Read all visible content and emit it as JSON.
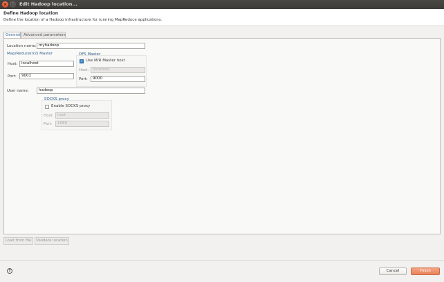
{
  "window": {
    "title": "Edit Hadoop location...",
    "close_icon": "close-icon",
    "maximize_icon": "maximize-icon"
  },
  "header": {
    "title": "Define Hadoop location",
    "description": "Define the location of a Hadoop infrastructure for running MapReduce applications."
  },
  "tabs": [
    {
      "label": "General",
      "selected": true
    },
    {
      "label": "Advanced parameters",
      "selected": false
    }
  ],
  "general": {
    "location_name_label": "Location name:",
    "location_name_value": "myhadoop",
    "mapreduce": {
      "title": "Map/Reduce(V2) Master",
      "host_label": "Host:",
      "host_value": "localhost",
      "port_label": "Port:",
      "port_value": "9001"
    },
    "dfs": {
      "title": "DFS Master",
      "use_mr_host_label": "Use M/R Master host",
      "use_mr_host_checked": true,
      "host_label": "Host:",
      "host_value": "localhost",
      "port_label": "Port:",
      "port_value": "9000"
    },
    "user_name_label": "User name:",
    "user_name_value": "hadoop",
    "socks": {
      "title": "SOCKS proxy",
      "enable_label": "Enable SOCKS proxy",
      "enable_checked": false,
      "host_label": "Host:",
      "host_value": "host",
      "port_label": "Port:",
      "port_value": "1080"
    }
  },
  "bottom_buttons": {
    "load_from_file": "Load from file",
    "validate_location": "Validate location"
  },
  "footer": {
    "help_icon": "help-icon",
    "cancel": "Cancel",
    "finish": "Finish"
  },
  "colors": {
    "accent_orange": "#e8835a",
    "group_title_blue": "#2f5f8f",
    "checkbox_blue": "#3a7fc0"
  }
}
